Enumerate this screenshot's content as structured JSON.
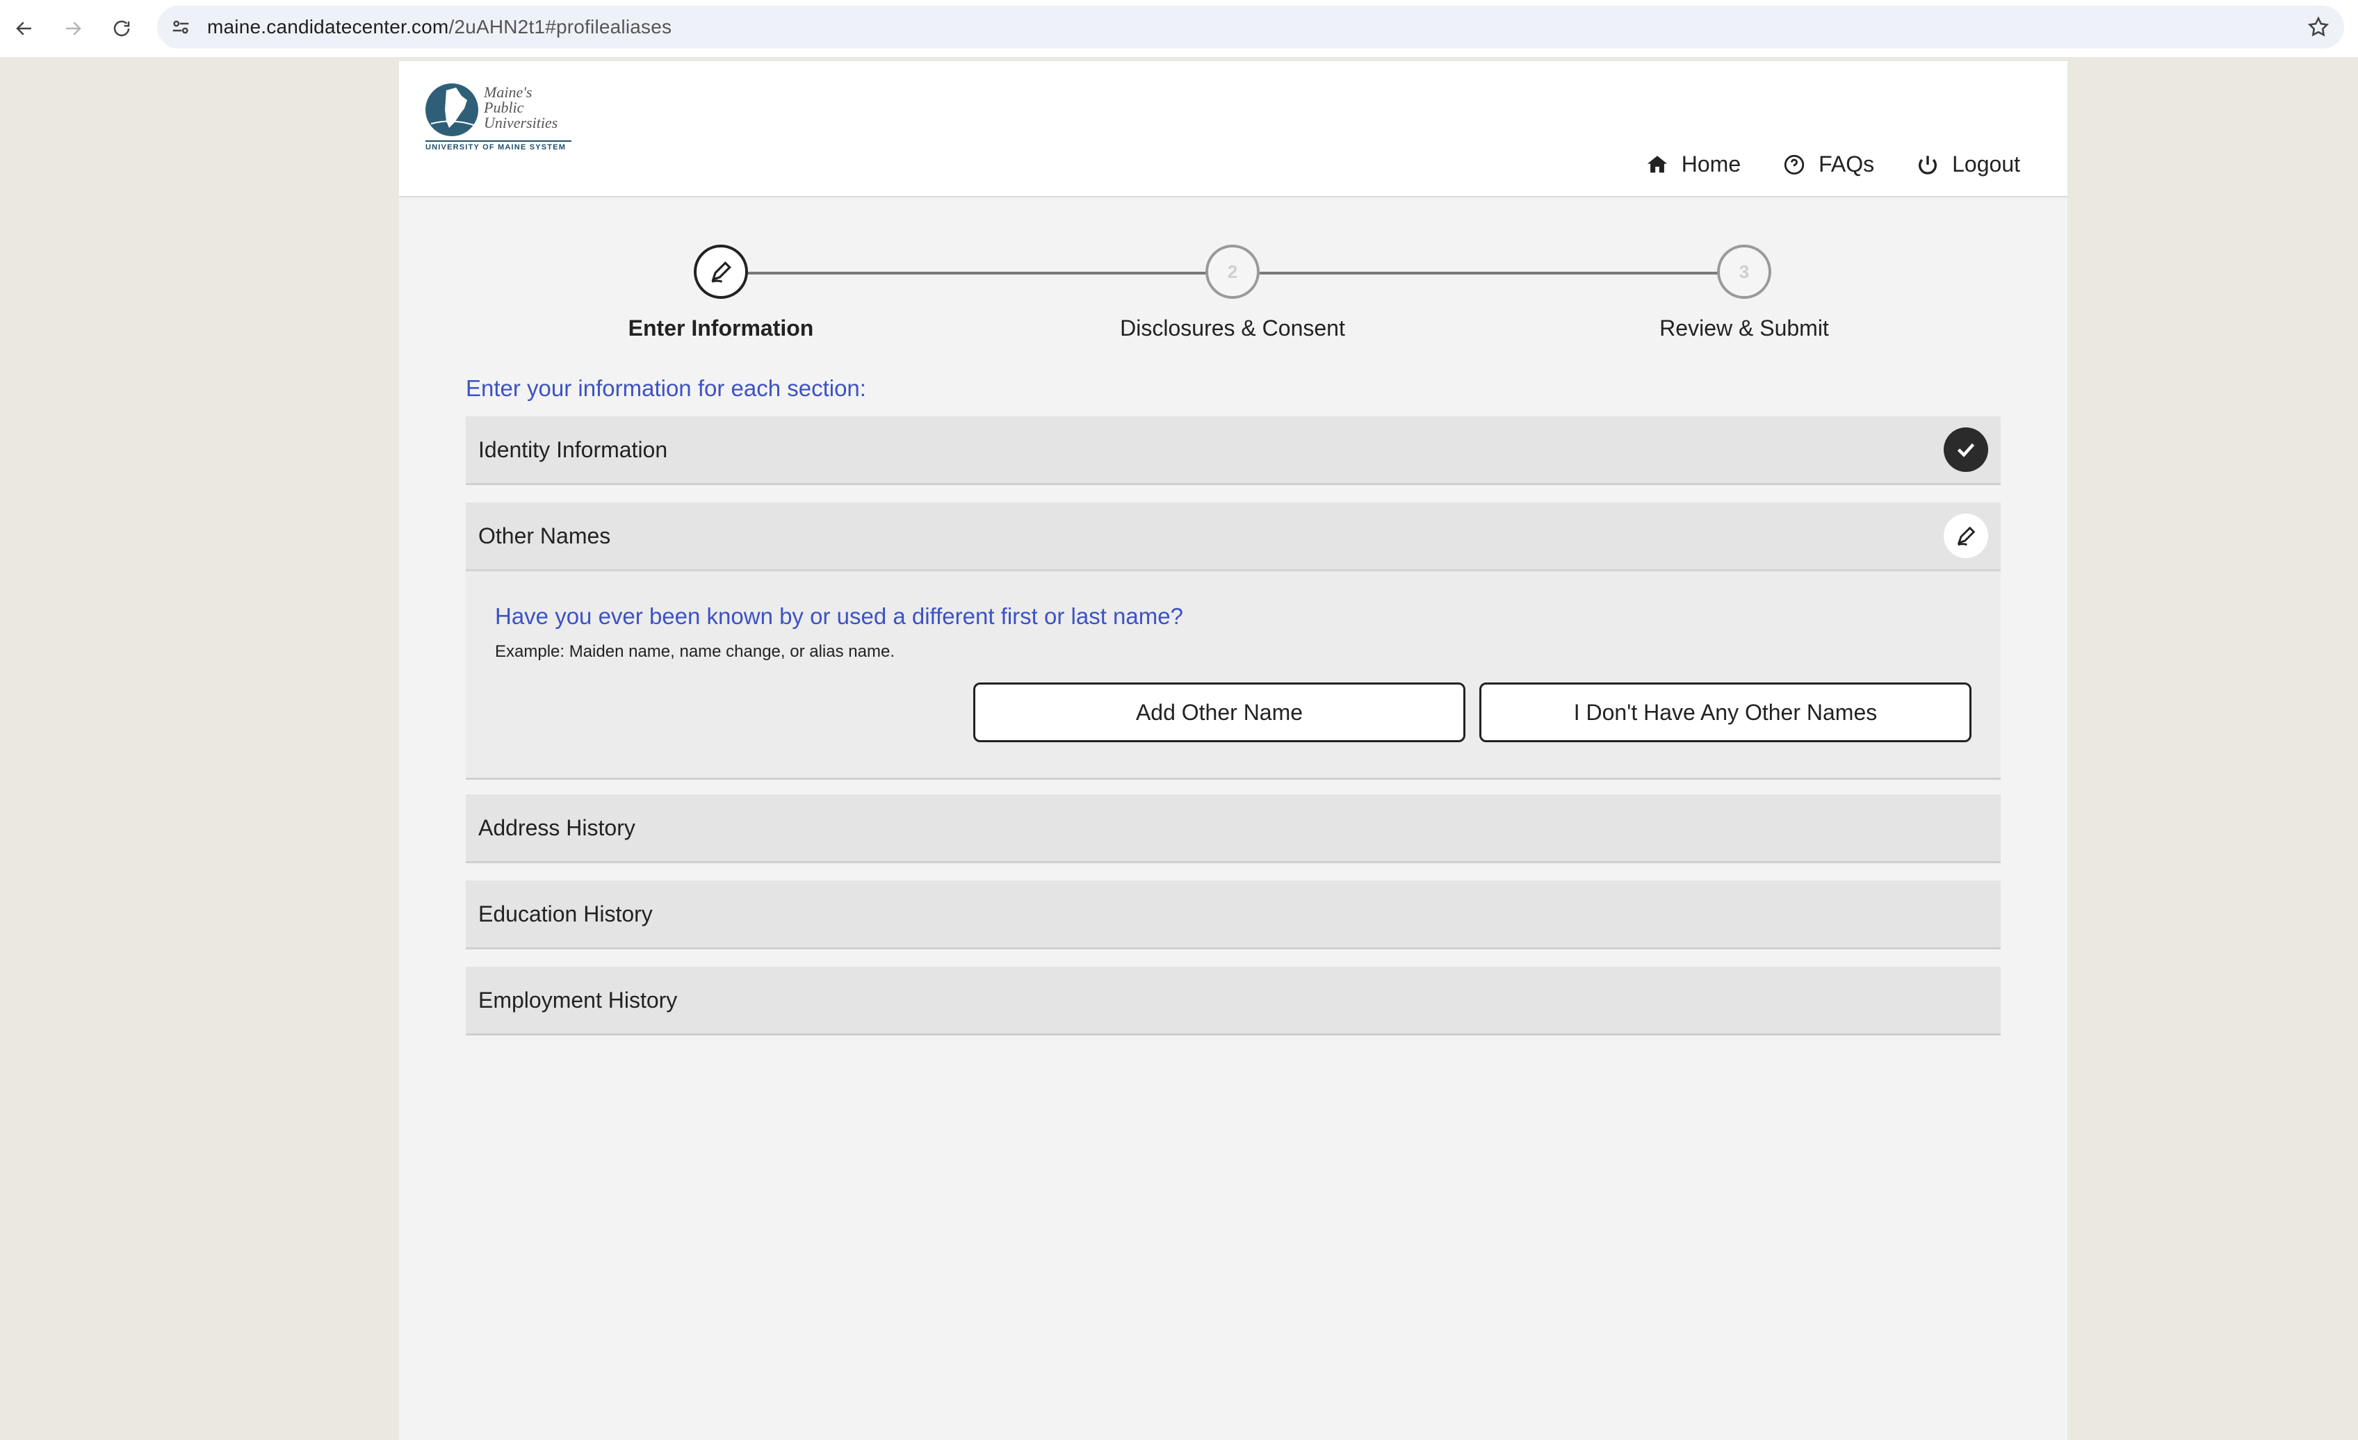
{
  "browser": {
    "url_host": "maine.candidatecenter.com",
    "url_path": "/2uAHN2t1#profilealiases"
  },
  "logo": {
    "line1": "Maine's",
    "line2": "Public",
    "line3": "Universities",
    "sub": "UNIVERSITY OF MAINE SYSTEM"
  },
  "nav": {
    "home": "Home",
    "faqs": "FAQs",
    "logout": "Logout"
  },
  "stepper": {
    "steps": [
      {
        "number": "1",
        "label": "Enter Information",
        "active": true
      },
      {
        "number": "2",
        "label": "Disclosures & Consent",
        "active": false
      },
      {
        "number": "3",
        "label": "Review & Submit",
        "active": false
      }
    ]
  },
  "main": {
    "instructions": "Enter your information for each section:",
    "sections": [
      {
        "title": "Identity Information",
        "status": "complete"
      },
      {
        "title": "Other Names",
        "status": "editing"
      },
      {
        "title": "Address History",
        "status": "none"
      },
      {
        "title": "Education History",
        "status": "none"
      },
      {
        "title": "Employment History",
        "status": "none"
      }
    ],
    "other_names": {
      "question": "Have you ever been known by or used a different first or last name?",
      "example": "Example: Maiden name, name change, or alias name.",
      "add_button": "Add Other Name",
      "none_button": "I Don't Have Any Other Names"
    }
  }
}
